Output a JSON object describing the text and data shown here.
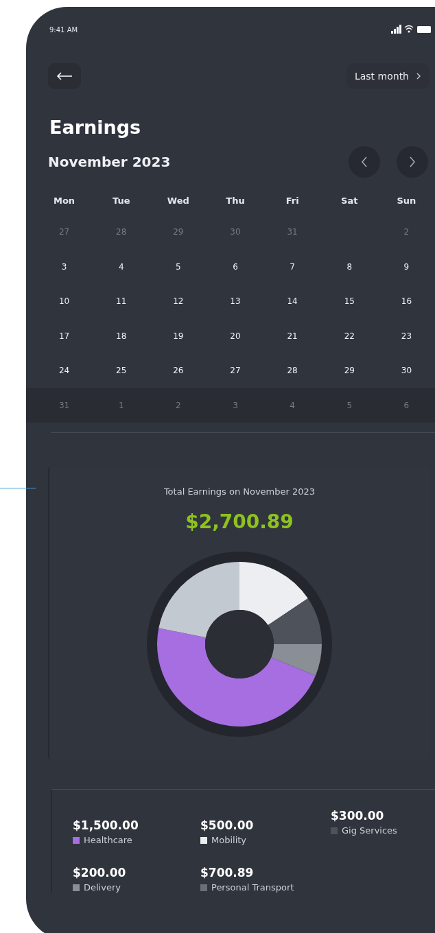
{
  "status_bar": {
    "time": "9:41 AM"
  },
  "header": {
    "period": "Last month"
  },
  "title": "Earnings",
  "calendar": {
    "month": "November 2023",
    "weekdays": [
      "Mon",
      "Tue",
      "Wed",
      "Thu",
      "Fri",
      "Sat",
      "Sun"
    ],
    "weeks": [
      [
        {
          "kind": "day",
          "day": "27",
          "muted": true
        },
        {
          "kind": "day",
          "day": "28",
          "muted": true
        },
        {
          "kind": "day",
          "day": "29",
          "muted": true
        },
        {
          "kind": "day",
          "day": "30",
          "muted": true
        },
        {
          "kind": "day",
          "day": "31",
          "muted": true
        },
        {
          "kind": "empty"
        },
        {
          "kind": "day",
          "day": "2",
          "muted": true
        }
      ],
      [
        {
          "kind": "day",
          "day": "3",
          "muted": false
        },
        {
          "kind": "day",
          "day": "4",
          "muted": false
        },
        {
          "kind": "day",
          "day": "5",
          "muted": false
        },
        {
          "kind": "day",
          "day": "6",
          "muted": false
        },
        {
          "kind": "day",
          "day": "7",
          "muted": false
        },
        {
          "kind": "day",
          "day": "8",
          "muted": false
        },
        {
          "kind": "day",
          "day": "9",
          "muted": false
        }
      ],
      [
        {
          "kind": "day",
          "day": "10",
          "muted": false
        },
        {
          "kind": "day",
          "day": "11",
          "muted": false
        },
        {
          "kind": "day",
          "day": "12",
          "muted": false
        },
        {
          "kind": "day",
          "day": "13",
          "muted": false
        },
        {
          "kind": "day",
          "day": "14",
          "muted": false
        },
        {
          "kind": "day",
          "day": "15",
          "muted": false
        },
        {
          "kind": "day",
          "day": "16",
          "muted": false
        }
      ],
      [
        {
          "kind": "day",
          "day": "17",
          "muted": false
        },
        {
          "kind": "day",
          "day": "18",
          "muted": false
        },
        {
          "kind": "day",
          "day": "19",
          "muted": false
        },
        {
          "kind": "day",
          "day": "20",
          "muted": false
        },
        {
          "kind": "day",
          "day": "21",
          "muted": false
        },
        {
          "kind": "day",
          "day": "22",
          "muted": false
        },
        {
          "kind": "day",
          "day": "23",
          "muted": false
        }
      ],
      [
        {
          "kind": "day",
          "day": "24",
          "muted": false
        },
        {
          "kind": "day",
          "day": "25",
          "muted": false
        },
        {
          "kind": "day",
          "day": "26",
          "muted": false
        },
        {
          "kind": "day",
          "day": "27",
          "muted": false
        },
        {
          "kind": "day",
          "day": "28",
          "muted": false
        },
        {
          "kind": "day",
          "day": "29",
          "muted": false
        },
        {
          "kind": "day",
          "day": "30",
          "muted": false
        }
      ],
      [
        {
          "kind": "day",
          "day": "31",
          "muted": true
        },
        {
          "kind": "day",
          "day": "1",
          "muted": true
        },
        {
          "kind": "day",
          "day": "2",
          "muted": true
        },
        {
          "kind": "day",
          "day": "3",
          "muted": true
        },
        {
          "kind": "day",
          "day": "4",
          "muted": true
        },
        {
          "kind": "day",
          "day": "5",
          "muted": true
        },
        {
          "kind": "day",
          "day": "6",
          "muted": true
        }
      ]
    ]
  },
  "summary": {
    "label": "Total Earnings on November 2023",
    "total": "$2,700.89"
  },
  "legend": [
    {
      "amount": "$1,500.00",
      "label": "Healthcare",
      "color": "#a66ee0"
    },
    {
      "amount": "$500.00",
      "label": "Mobility",
      "color": "#eceef2"
    },
    {
      "amount": "$300.00",
      "label": "Gig Services",
      "color": "#4e525b"
    },
    {
      "amount": "$200.00",
      "label": "Delivery",
      "color": "#8a8e95"
    },
    {
      "amount": "$700.89",
      "label": "Personal Transport",
      "color": "#6b6f77"
    }
  ]
}
